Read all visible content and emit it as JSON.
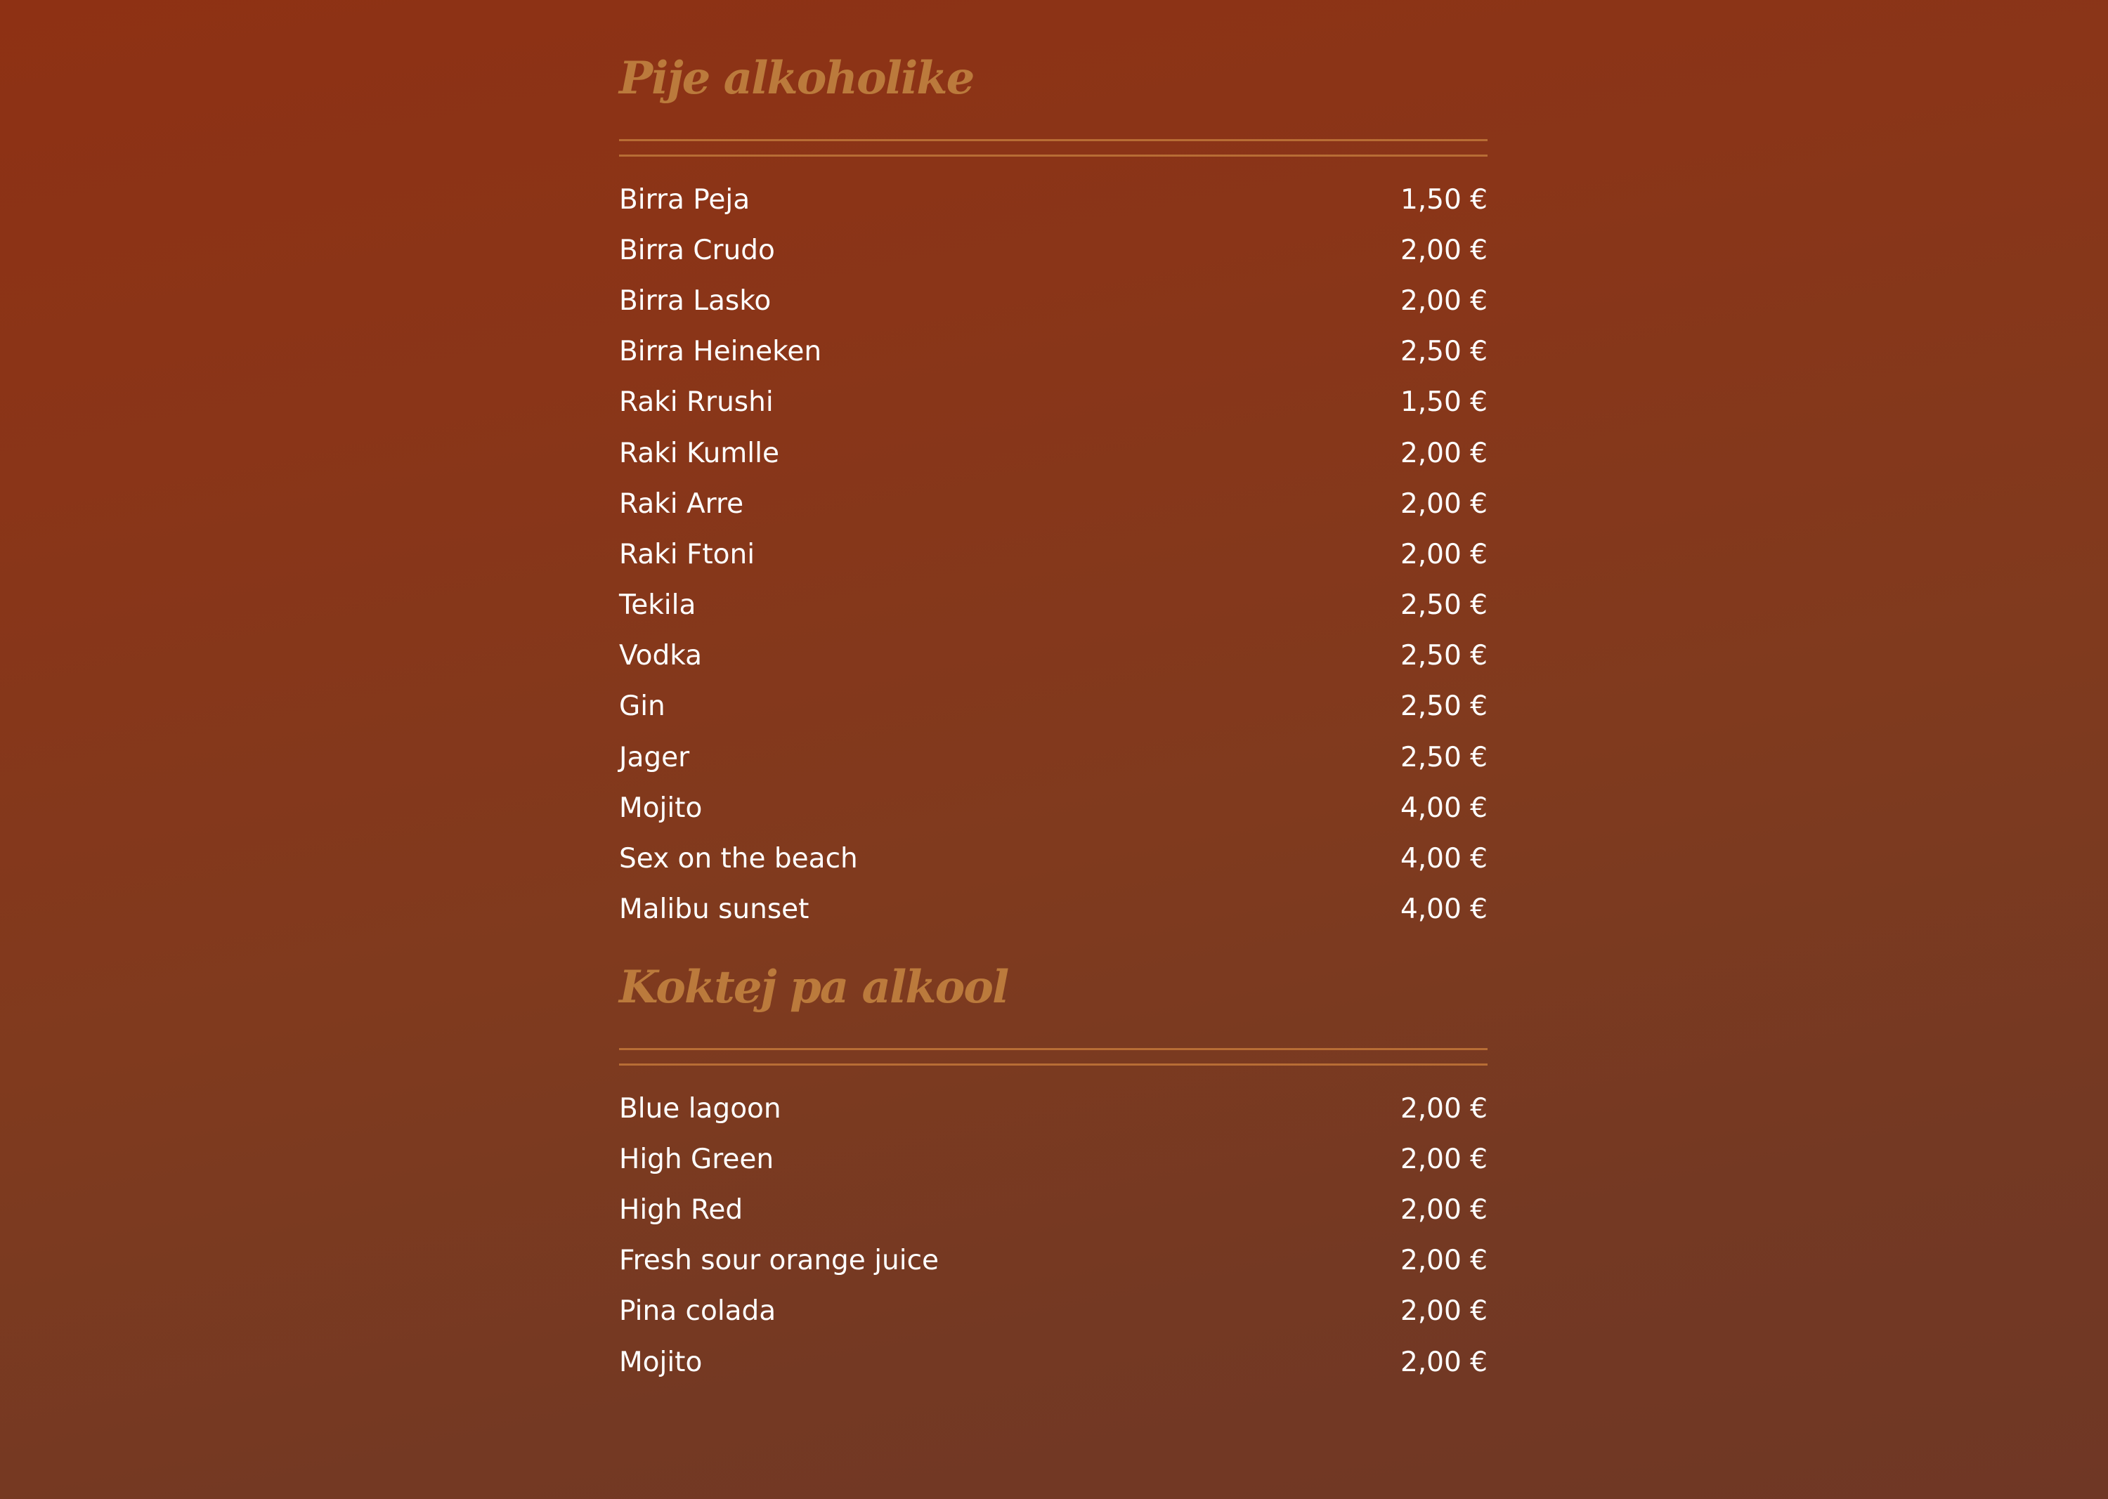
{
  "sections": [
    {
      "title": "Pije alkoholike",
      "items": [
        {
          "name": "Birra Peja",
          "price": "1,50 €"
        },
        {
          "name": "Birra Crudo",
          "price": "2,00 €"
        },
        {
          "name": "Birra Lasko",
          "price": "2,00 €"
        },
        {
          "name": "Birra Heineken",
          "price": "2,50 €"
        },
        {
          "name": "Raki Rrushi",
          "price": "1,50 €"
        },
        {
          "name": "Raki Kumlle",
          "price": "2,00 €"
        },
        {
          "name": "Raki Arre",
          "price": "2,00 €"
        },
        {
          "name": "Raki Ftoni",
          "price": "2,00 €"
        },
        {
          "name": "Tekila",
          "price": "2,50 €"
        },
        {
          "name": "Vodka",
          "price": "2,50 €"
        },
        {
          "name": "Gin",
          "price": "2,50 €"
        },
        {
          "name": "Jager",
          "price": "2,50 €"
        },
        {
          "name": "Mojito",
          "price": "4,00 €"
        },
        {
          "name": "Sex on the beach",
          "price": "4,00 €"
        },
        {
          "name": "Malibu sunset",
          "price": "4,00 €"
        }
      ]
    },
    {
      "title": "Koktej pa alkool",
      "items": [
        {
          "name": "Blue lagoon",
          "price": "2,00 €"
        },
        {
          "name": "High Green",
          "price": "2,00 €"
        },
        {
          "name": "High Red",
          "price": "2,00 €"
        },
        {
          "name": "Fresh sour orange juice",
          "price": "2,00 €"
        },
        {
          "name": "Pina colada",
          "price": "2,00 €"
        },
        {
          "name": "Mojito",
          "price": "2,00 €"
        }
      ]
    }
  ],
  "colors": {
    "heading": "#bb7a3c",
    "rule": "#b86d35",
    "text": "#ffffff",
    "background_top": "#8e3114",
    "background_bottom": "#6f3725"
  }
}
